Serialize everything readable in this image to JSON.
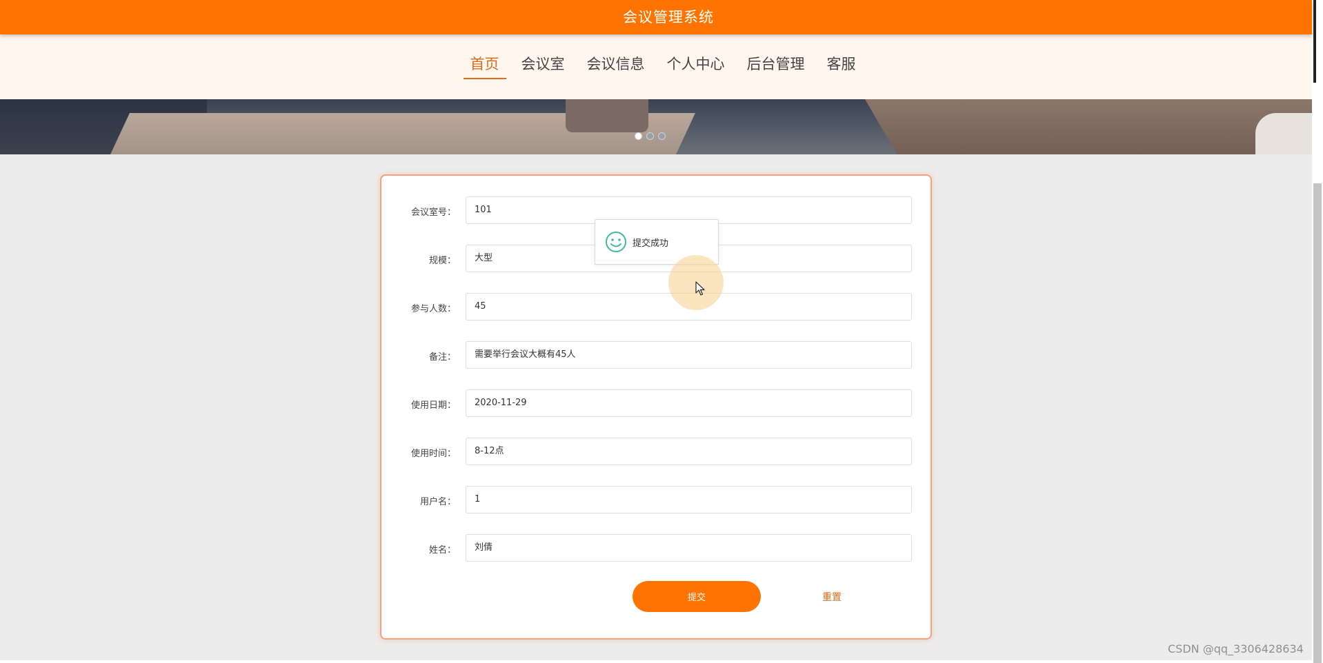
{
  "header": {
    "title": "会议管理系统"
  },
  "nav": {
    "items": [
      {
        "label": "首页",
        "active": true
      },
      {
        "label": "会议室",
        "active": false
      },
      {
        "label": "会议信息",
        "active": false
      },
      {
        "label": "个人中心",
        "active": false
      },
      {
        "label": "后台管理",
        "active": false
      },
      {
        "label": "客服",
        "active": false
      }
    ]
  },
  "carousel": {
    "slide_count": 3,
    "active_index": 0
  },
  "form": {
    "fields": [
      {
        "label": "会议室号：",
        "value": "101"
      },
      {
        "label": "规模：",
        "value": "大型"
      },
      {
        "label": "参与人数：",
        "value": "45"
      },
      {
        "label": "备注：",
        "value": "需要举行会议大概有45人"
      },
      {
        "label": "使用日期：",
        "value": "2020-11-29"
      },
      {
        "label": "使用时间：",
        "value": "8-12点"
      },
      {
        "label": "用户名：",
        "value": "1"
      },
      {
        "label": "姓名：",
        "value": "刘倩"
      }
    ],
    "submit_label": "提交",
    "reset_label": "重置"
  },
  "toast": {
    "message": "提交成功",
    "icon": "smile-icon"
  },
  "watermark": "CSDN @qq_3306428634",
  "colors": {
    "brand": "#ff7400",
    "nav_bg": "#fff6ee",
    "active_nav": "#e06b1d",
    "card_border": "#f4a27c",
    "success_icon": "#3cbf8d"
  }
}
